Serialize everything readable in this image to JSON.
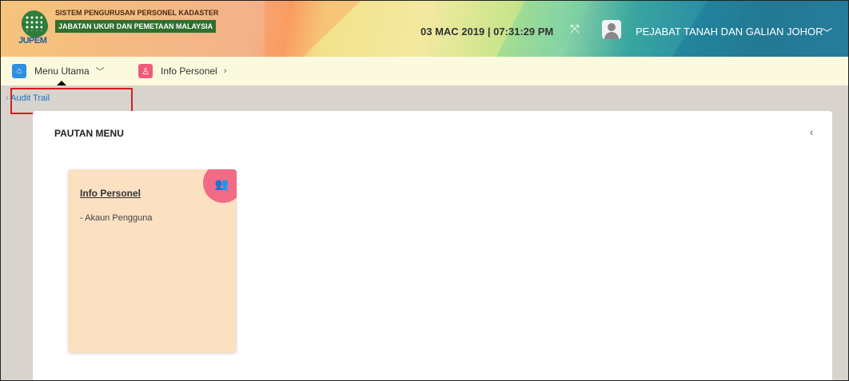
{
  "header": {
    "system_title": "SISTEM PENGURUSAN PERSONEL KADASTER",
    "system_subtitle": "JABATAN UKUR DAN PEMETAAN MALAYSIA",
    "logo_text": "JUPEM",
    "datetime": "03 MAC 2019 | 07:31:29 PM",
    "office": "PEJABAT TANAH DAN GALIAN JOHOR",
    "icons": {
      "expand": "expand-icon",
      "avatar": "user-avatar-icon",
      "dropdown": "chevron-down-icon"
    }
  },
  "nav": {
    "items": [
      {
        "label": "Menu Utama",
        "icon": "home-icon",
        "color": "#2f8fe0",
        "chevron": "﹀"
      },
      {
        "label": "Info Personel",
        "icon": "user-icon",
        "color": "#ef5b78",
        "chevron": "›"
      }
    ]
  },
  "breadcrumb": {
    "label": "Audit Trail",
    "prefix": "›"
  },
  "panel": {
    "title": "PAUTAN MENU",
    "collapse_glyph": "‹"
  },
  "cards": [
    {
      "title": "Info Personel",
      "items": [
        "- Akaun Pengguna"
      ],
      "badge_color": "#f26b86",
      "background": "#fbe0c2"
    }
  ]
}
